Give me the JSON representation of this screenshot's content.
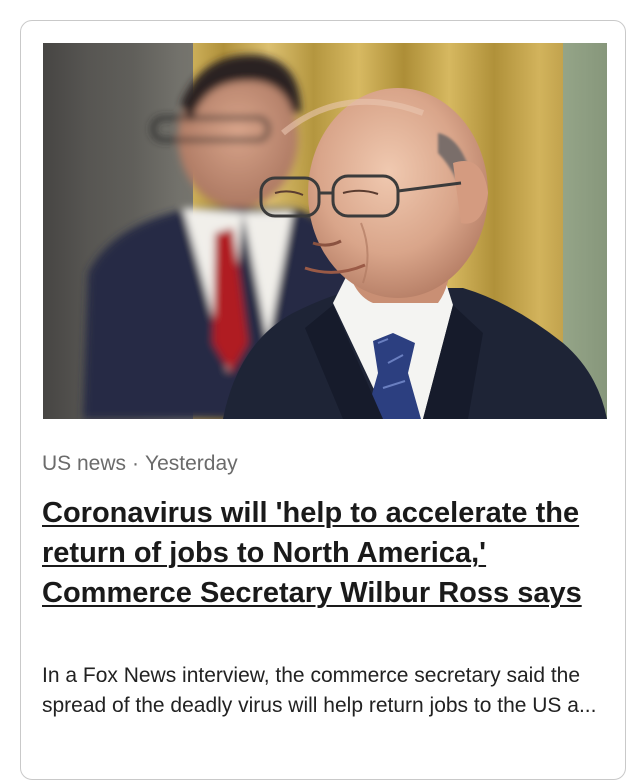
{
  "article": {
    "category": "US news",
    "separator": "·",
    "time": "Yesterday",
    "headline": "Coronavirus will 'help to accelerate the return of jobs to North America,' Commerce Secretary Wilbur Ross says",
    "snippet": "In a Fox News interview, the commerce secretary said the spread of the deadly virus will help return jobs to the US a..."
  },
  "colors": {
    "meta_text": "#6b6b6b",
    "headline_text": "#1a1a1a",
    "card_border": "#c9c9c9"
  }
}
